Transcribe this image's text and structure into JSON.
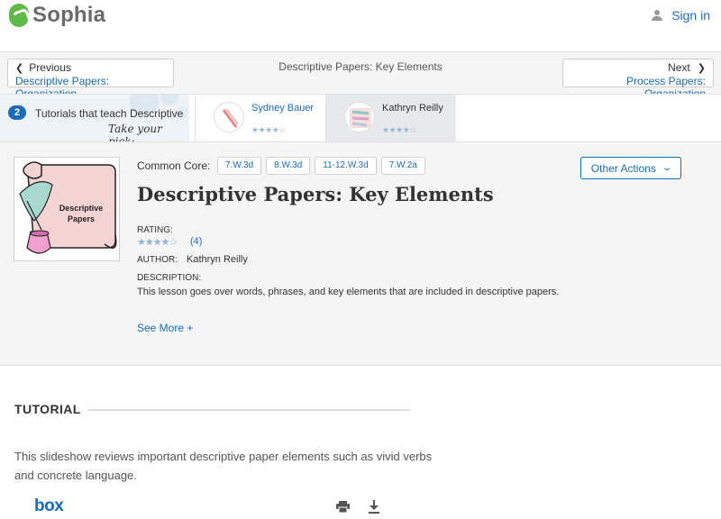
{
  "header": {
    "logo_text": "Sophia",
    "signin_label": "Sign in"
  },
  "nav": {
    "prev": {
      "label": "Previous",
      "title": "Descriptive Papers: Organization"
    },
    "current_title": "Descriptive Papers: Key Elements",
    "next": {
      "label": "Next",
      "title": "Process Papers: Organization"
    }
  },
  "tutorials": {
    "count": "2",
    "label": "Tutorials that teach Descriptive",
    "pick": "Take your pick:",
    "teachers": [
      {
        "name": "Sydney Bauer",
        "rating": 4,
        "selected": false
      },
      {
        "name": "Kathryn Reilly",
        "rating": 4,
        "selected": true
      }
    ]
  },
  "lesson": {
    "thumbnail_text": "Descriptive Papers",
    "common_core_label": "Common Core:",
    "common_core_tags": [
      "7.W.3d",
      "8.W.3d",
      "11-12.W.3d",
      "7.W.2a"
    ],
    "other_actions_label": "Other Actions",
    "title": "Descriptive Papers: Key Elements",
    "rating_label": "RATING:",
    "rating_stars": 4,
    "rating_count": "(4)",
    "author_label": "AUTHOR:",
    "author_name": "Kathryn Reilly",
    "description_label": "DESCRIPTION:",
    "description": "This lesson goes over words, phrases, and key elements that are included in descriptive papers.",
    "see_more_label": "See More +"
  },
  "tutorial_section": {
    "title": "TUTORIAL",
    "description": "This slideshow reviews important descriptive paper elements such as vivid verbs and concrete language.",
    "embed_logo": "box"
  },
  "colors": {
    "brand_green": "#5fba47",
    "link_blue": "#1a6bb8",
    "panel_gray": "#f5f5f5"
  }
}
